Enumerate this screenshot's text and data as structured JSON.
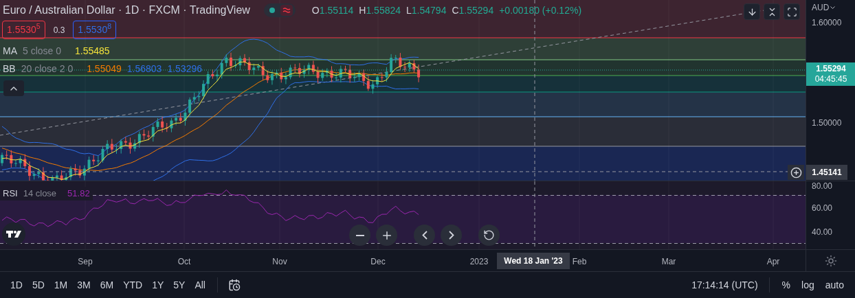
{
  "header": {
    "title": "Euro / Australian Dollar · 1D · FXCM · TradingView"
  },
  "ohlc": [
    {
      "label": "O",
      "value": "1.55114"
    },
    {
      "label": "H",
      "value": "1.55824"
    },
    {
      "label": "L",
      "value": "1.54794"
    },
    {
      "label": "C",
      "value": "1.55294"
    }
  ],
  "change": "+0.00180 (+0.12%)",
  "quote": {
    "bid": "1.5530$^{5}$",
    "spread": "0.3",
    "ask": "1.5530$^{8}$"
  },
  "indicators": [
    {
      "name": "MA",
      "params": "5 close 0",
      "values": [
        {
          "text": "1.55485",
          "color": "#f5e43b"
        }
      ]
    },
    {
      "name": "BB",
      "params": "20 close 2 0",
      "values": [
        {
          "text": "1.55049",
          "color": "#f57c00"
        },
        {
          "text": "1.56803",
          "color": "#2f6fe6"
        },
        {
          "text": "1.53296",
          "color": "#2f6fe6"
        }
      ]
    }
  ],
  "rsi": {
    "name": "RSI",
    "params": "14 close",
    "value": "51.82"
  },
  "price_axis": {
    "currency": "AUD",
    "labels": [
      "1.60000",
      "1.50000"
    ],
    "last_price": "1.55294",
    "countdown": "04:45:45",
    "crosshair_price": "1.45141"
  },
  "rsi_axis": [
    "80.00",
    "60.00",
    "40.00"
  ],
  "time_axis": {
    "labels": [
      "Sep",
      "Oct",
      "Nov",
      "Dec",
      "2023",
      "Feb",
      "Mar",
      "Apr"
    ],
    "crosshair_date": "Wed 18 Jan '23"
  },
  "ranges": [
    "1D",
    "5D",
    "1M",
    "3M",
    "6M",
    "YTD",
    "1Y",
    "5Y",
    "All"
  ],
  "clock": "17:14:14 (UTC)",
  "scale_options": [
    "%",
    "log",
    "auto"
  ]
}
